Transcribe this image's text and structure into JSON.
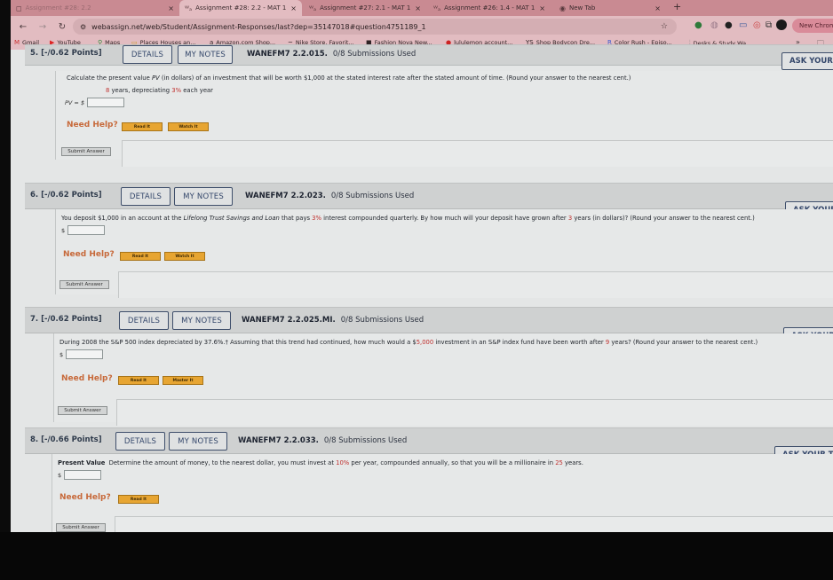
{
  "browser": {
    "tabs": [
      {
        "label": "Assignment #28: 2.2",
        "icon": "webassign-icon",
        "state": "dim"
      },
      {
        "label": "Assignment #28: 2.2 - MAT 1",
        "icon": "webassign-icon",
        "state": "active"
      },
      {
        "label": "Assignment #27: 2.1 - MAT 1",
        "icon": "webassign-icon",
        "state": "normal"
      },
      {
        "label": "Assignment #26: 1.4 - MAT 1",
        "icon": "webassign-icon",
        "state": "normal"
      },
      {
        "label": "New Tab",
        "icon": "chrome-icon",
        "state": "normal"
      }
    ],
    "new_tab_symbol": "+",
    "minimize_symbol": "⌄",
    "close_symbol": "×",
    "nav": {
      "back": "←",
      "forward": "→",
      "reload": "↻"
    },
    "url": "webassign.net/web/Student/Assignment-Responses/last?dep=35147018#question4751189_1",
    "new_chrome_label": "New Chrome",
    "bookmarks": [
      {
        "label": "Gmail",
        "icon": "gmail-icon"
      },
      {
        "label": "YouTube",
        "icon": "youtube-icon"
      },
      {
        "label": "Maps",
        "icon": "maps-icon"
      },
      {
        "label": "Places Houses an...",
        "icon": "folder-icon"
      },
      {
        "label": "Amazon.com Shop...",
        "icon": "amazon-icon"
      },
      {
        "label": "Nike Store. Favorit...",
        "icon": "nike-icon"
      },
      {
        "label": "Fashion Nova New...",
        "icon": "fashionnova-icon"
      },
      {
        "label": "lululemon account...",
        "icon": "lululemon-icon"
      },
      {
        "label": "Shop Bodycon Dre...",
        "icon": "ys-icon"
      },
      {
        "label": "Color Rush - Episo...",
        "icon": "color-rush-icon"
      },
      {
        "label": "Desks & Study Wa...",
        "icon": "desks-icon"
      }
    ],
    "bookmarks_more": "»"
  },
  "common": {
    "details_label": "DETAILS",
    "my_notes_label": "MY NOTES",
    "ask_label": "ASK YOUR TEACHER",
    "need_help_label": "Need Help?",
    "submit_label": "Submit Answer",
    "dollar_sign": "$"
  },
  "questions": [
    {
      "number": "5.",
      "points": "[-/0.62 Points]",
      "code": "WANEFM7 2.2.015.",
      "submissions": "0/8 Submissions Used",
      "text_parts": {
        "a": "Calculate the present value ",
        "b": "PV",
        "c": " (in dollars) of an investment that will be worth $1,000 at the stated interest rate after the stated amount of time. (Round your answer to the nearest cent.)"
      },
      "sub_parts": {
        "a": "8",
        "b": " years, depreciating ",
        "c": "3%",
        "d": " each year"
      },
      "answer_label": "PV = $",
      "answer_value": "",
      "help_buttons": [
        "Read It",
        "Watch It"
      ]
    },
    {
      "number": "6.",
      "points": "[-/0.62 Points]",
      "code": "WANEFM7 2.2.023.",
      "submissions": "0/8 Submissions Used",
      "text_parts": {
        "a": "You deposit $1,000 in an account at the ",
        "b": "Lifelong Trust Savings and Loan",
        "c": " that pays ",
        "d": "3%",
        "e": " interest compounded quarterly. By how much will your deposit have grown after ",
        "f": "3",
        "g": " years (in dollars)? (Round your answer to the nearest cent.)"
      },
      "answer_value": "",
      "help_buttons": [
        "Read It",
        "Watch It"
      ]
    },
    {
      "number": "7.",
      "points": "[-/0.62 Points]",
      "code": "WANEFM7 2.2.025.MI.",
      "submissions": "0/8 Submissions Used",
      "text_parts": {
        "a": "During 2008 the S&P 500 index depreciated by 37.6%.† Assuming that this trend had continued, how much would a $",
        "b": "5,000",
        "c": " investment in an S&P index fund have been worth after ",
        "d": "9",
        "e": " years? (Round your answer to the nearest cent.)"
      },
      "answer_value": "",
      "help_buttons": [
        "Read It",
        "Master It"
      ]
    },
    {
      "number": "8.",
      "points": "[-/0.66 Points]",
      "code": "WANEFM7 2.2.033.",
      "submissions": "0/8 Submissions Used",
      "text_parts": {
        "label": "Present Value",
        "a": "Determine the amount of money, to the nearest dollar, you must invest at ",
        "b": "10%",
        "c": " per year, compounded annually, so that you will be a millionaire in ",
        "d": "25",
        "e": " years."
      },
      "answer_value": "",
      "help_buttons": [
        "Read It"
      ]
    }
  ],
  "colors": {
    "accent_red": "#c0312f",
    "need_help": "#c7693a",
    "help_button": "#e7a532",
    "tab_bar": "#c98a92",
    "button_border": "#3f4f6b"
  }
}
